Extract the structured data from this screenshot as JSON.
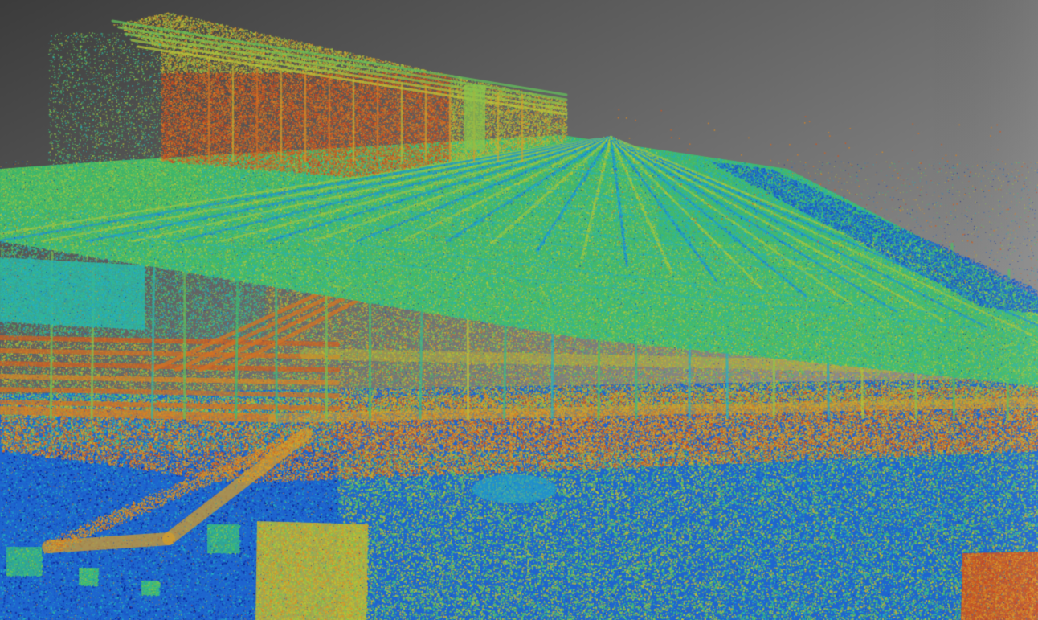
{
  "viewer": {
    "view": "point-cloud-3d",
    "colormap": "intensity-jet",
    "background_gradient": [
      "#3c3c3c",
      "#8a8a8a"
    ],
    "colormap_stops": [
      "#0a1a8c",
      "#1e5fd0",
      "#23b2c8",
      "#3fbf6a",
      "#b8c83a",
      "#d99a2a",
      "#c8321c"
    ]
  }
}
